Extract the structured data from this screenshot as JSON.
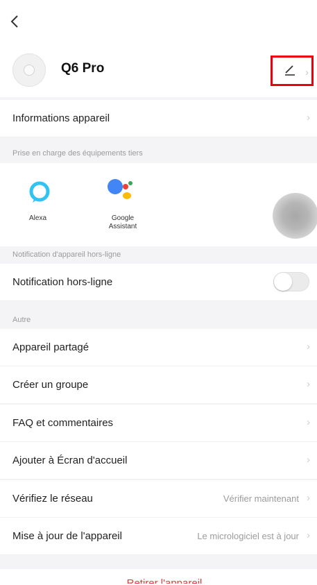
{
  "header": {
    "back_icon": "chevron-left-icon"
  },
  "device": {
    "name": "Q6 Pro",
    "edit_icon": "pencil-icon",
    "highlight_color": "#e8000f"
  },
  "rows": {
    "info": {
      "label": "Informations appareil"
    },
    "offline": {
      "label": "Notification hors-ligne",
      "enabled": false
    },
    "shared": {
      "label": "Appareil partagé"
    },
    "group": {
      "label": "Créer un groupe"
    },
    "faq": {
      "label": "FAQ et commentaires"
    },
    "home": {
      "label": "Ajouter à Écran d'accueil"
    },
    "network": {
      "label": "Vérifiez le réseau",
      "value": "Vérifier maintenant"
    },
    "update": {
      "label": "Mise à jour de l'appareil",
      "value": "Le micrologiciel est à jour"
    }
  },
  "sections": {
    "third_party": "Prise en charge des équipements tiers",
    "offline": "Notification d'appareil hors-ligne",
    "other": "Autre"
  },
  "third_party": {
    "alexa": {
      "label": "Alexa"
    },
    "google": {
      "line1": "Google",
      "line2": "Assistant"
    }
  },
  "footer": {
    "remove_label": "Retirer l'appareil"
  }
}
